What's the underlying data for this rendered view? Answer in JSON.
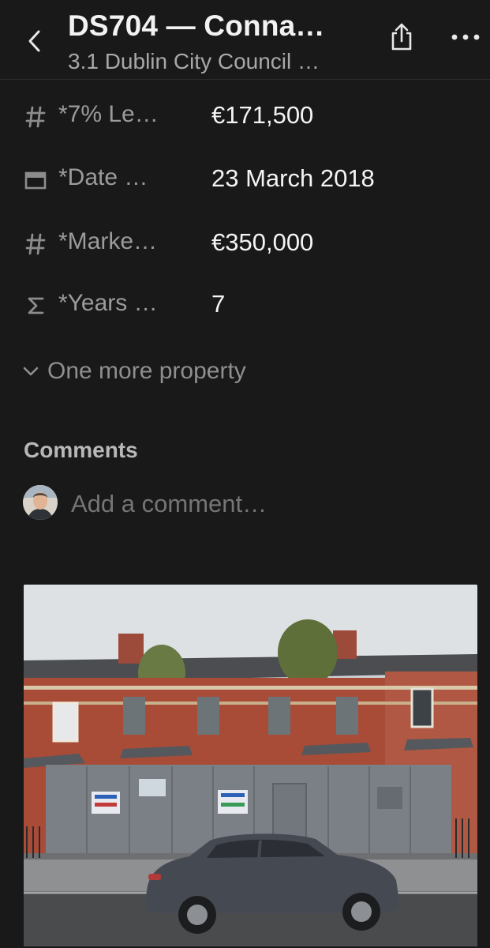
{
  "header": {
    "title": "DS704 — Conna…",
    "subtitle": "3.1 Dublin City Council …",
    "icons": {
      "back": "chevron-left-icon",
      "share": "share-icon",
      "more": "more-horizontal-icon"
    }
  },
  "properties": [
    {
      "icon": "number-icon",
      "name": "*7% Le…",
      "value": "€171,500"
    },
    {
      "icon": "calendar-icon",
      "name": "*Date …",
      "value": "23 March 2018"
    },
    {
      "icon": "number-icon",
      "name": "*Marke…",
      "value": "€350,000"
    },
    {
      "icon": "sigma-icon",
      "name": "*Years …",
      "value": "7"
    }
  ],
  "more_properties_label": "One more property",
  "comments": {
    "heading": "Comments",
    "placeholder": "Add a comment…"
  },
  "colors": {
    "background": "#191919",
    "text_primary": "#f4f4f4",
    "text_secondary": "#9b9b9b",
    "divider": "#2c2c2c"
  }
}
